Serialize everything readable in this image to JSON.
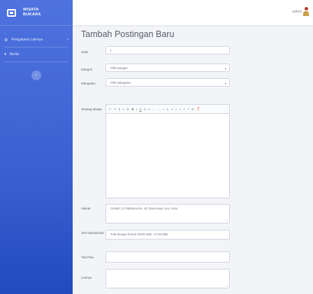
{
  "brand": {
    "line1": "WISATA",
    "line2": "BUKARA"
  },
  "sidebar": {
    "heading": "---",
    "items": [
      {
        "icon": "⚙",
        "label": "Pengaturan Lainnya"
      },
      {
        "icon": "♦",
        "label": "Berita"
      }
    ],
    "toggle_icon": "‹"
  },
  "topbar": {
    "user_name": "admin"
  },
  "page": {
    "title": "Tambah Postingan Baru"
  },
  "form": {
    "judul": {
      "label": "Judul",
      "value": "|"
    },
    "kategori": {
      "label": "Kategori",
      "value": "Pilih Kategori"
    },
    "kabupaten": {
      "label": "Kabupaten",
      "value": "Pilih Kabupaten"
    },
    "deskripsi": {
      "label": "Tentang Wisata"
    },
    "alamat": {
      "label": "Alamat",
      "value": "Contoh: Jl. Pattimura No. 19, Desa Kayu, Kec. Kota"
    },
    "jam": {
      "label": "Jam Operasional",
      "value": "Tulis dengan format: 08:00 WIB - 17:00 WIB"
    },
    "koordinat": {
      "label": "Titik Peta",
      "value": ""
    },
    "lainnya": {
      "label": "Lainnya",
      "value": ""
    }
  },
  "editor_tools": [
    "↶",
    "↷",
    "¶",
    "≡",
    "☰",
    "B",
    "I",
    "U",
    "S",
    "A",
    "←",
    "→",
    "•",
    "1.",
    "≡",
    "≡",
    "≡",
    "≡",
    "❝",
    "✉",
    "❓"
  ]
}
